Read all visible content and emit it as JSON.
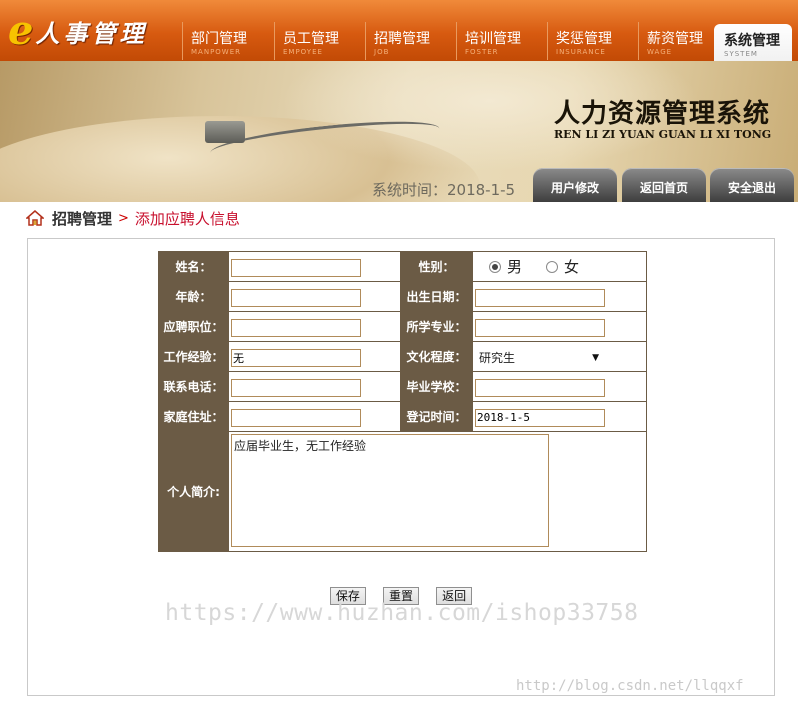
{
  "logo": {
    "letter": "e",
    "text": "人事管理"
  },
  "nav": [
    {
      "zh": "部门管理",
      "en": "MANPOWER"
    },
    {
      "zh": "员工管理",
      "en": "EMPOYEE"
    },
    {
      "zh": "招聘管理",
      "en": "JOB"
    },
    {
      "zh": "培训管理",
      "en": "FOSTER"
    },
    {
      "zh": "奖惩管理",
      "en": "INSURANCE"
    },
    {
      "zh": "薪资管理",
      "en": "WAGE"
    },
    {
      "zh": "系统管理",
      "en": "SYSTEM"
    }
  ],
  "banner": {
    "title_zh": "人力资源管理系统",
    "title_en": "REN LI ZI YUAN GUAN LI XI TONG",
    "time_label": "系统时间：2018-1-5",
    "buttons": [
      "用户修改",
      "返回首页",
      "安全退出"
    ]
  },
  "breadcrumb": {
    "section": "招聘管理",
    "sep": ">",
    "page": "添加应聘人信息"
  },
  "form": {
    "name_label": "姓名：",
    "gender_label": "性别：",
    "gender_male": "男",
    "gender_female": "女",
    "age_label": "年龄：",
    "birth_label": "出生日期：",
    "position_label": "应聘职位：",
    "major_label": "所学专业：",
    "experience_label": "工作经验：",
    "experience_value": "无",
    "education_label": "文化程度：",
    "education_value": "研究生",
    "phone_label": "联系电话：",
    "school_label": "毕业学校：",
    "address_label": "家庭住址：",
    "regtime_label": "登记时间：",
    "regtime_value": "2018-1-5",
    "intro_label": "个人简介:",
    "intro_value": "应届毕业生，无工作经验"
  },
  "buttons": {
    "save": "保存",
    "reset": "重置",
    "back": "返回"
  },
  "watermark": "https://www.huzhan.com/ishop33758",
  "csdn_watermark": "http://blog.csdn.net/llqqxf"
}
